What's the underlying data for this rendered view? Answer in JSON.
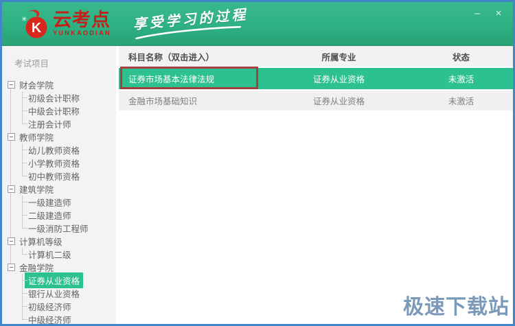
{
  "window": {
    "brand": "云考点",
    "brand_sub": "YUNKAODIAN",
    "slogan": "享受学习的过程",
    "controls": {
      "minimize": "–",
      "close": "×"
    }
  },
  "sidebar": {
    "header": "考试项目",
    "sections": [
      {
        "label": "财会学院",
        "children": [
          "初级会计职称",
          "中级会计职称",
          "注册会计师"
        ]
      },
      {
        "label": "教师学院",
        "children": [
          "幼儿教师资格",
          "小学教师资格",
          "初中教师资格"
        ]
      },
      {
        "label": "建筑学院",
        "children": [
          "一级建造师",
          "二级建造师",
          "一级消防工程师"
        ]
      },
      {
        "label": "计算机等级",
        "children": [
          "计算机二级"
        ]
      },
      {
        "label": "金融学院",
        "children": [
          "证券从业资格",
          "银行从业资格",
          "初级经济师",
          "中级经济师"
        ],
        "selected_child": "证券从业资格"
      }
    ]
  },
  "table": {
    "columns": [
      "科目名称（双击进入）",
      "所属专业",
      "状态"
    ],
    "rows": [
      {
        "subject": "证券市场基本法律法规",
        "major": "证券从业资格",
        "status": "未激活",
        "selected": true,
        "annotated": true
      },
      {
        "subject": "金融市场基础知识",
        "major": "证券从业资格",
        "status": "未激活",
        "selected": false,
        "annotated": false
      }
    ]
  },
  "watermark": "极速下载站",
  "colors": {
    "header_green": "#2eb183",
    "accent_green": "#2cc18f",
    "annotation_red": "#a73f42",
    "frame_blue": "#4285c9",
    "logo_red": "#c3201a",
    "watermark_blue": "#7b99b8"
  }
}
